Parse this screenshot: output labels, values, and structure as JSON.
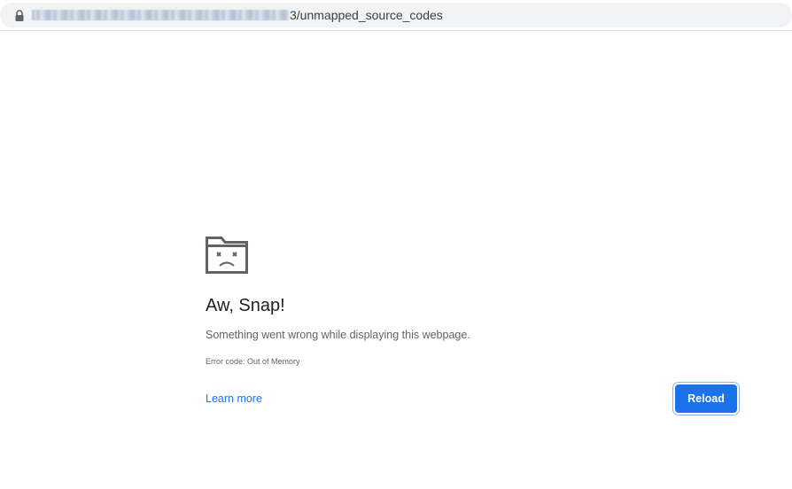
{
  "address_bar": {
    "url_path": "3/unmapped_source_codes"
  },
  "error": {
    "title": "Aw, Snap!",
    "message": "Something went wrong while displaying this webpage.",
    "code": "Error code: Out of Memory",
    "learn_more_label": "Learn more",
    "reload_label": "Reload"
  },
  "colors": {
    "accent": "#1a73e8",
    "title_text": "#202124",
    "body_text": "#5f6368",
    "omnibox_bg": "#f1f3f4"
  }
}
